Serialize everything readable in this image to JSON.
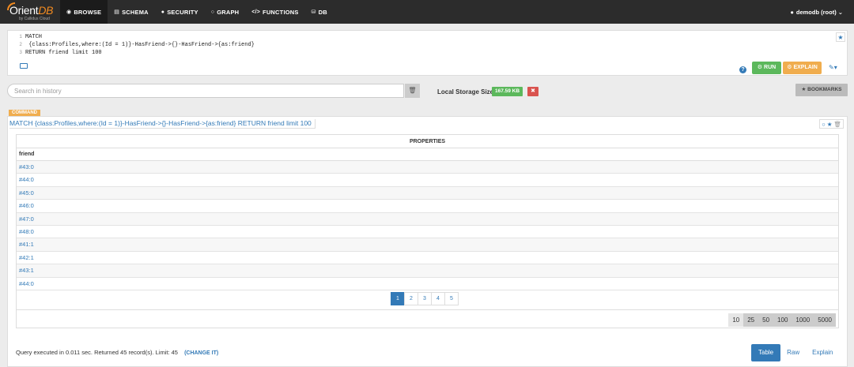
{
  "navbar": {
    "logo_text": "Orient",
    "logo_db": "DB",
    "logo_sub": "by Callidus Cloud",
    "items": [
      {
        "label": "BROWSE",
        "icon": "eye-icon",
        "glyph": "◉",
        "active": true
      },
      {
        "label": "SCHEMA",
        "icon": "table-icon",
        "glyph": "▤",
        "active": false
      },
      {
        "label": "SECURITY",
        "icon": "user-icon",
        "glyph": "👤",
        "active": false
      },
      {
        "label": "GRAPH",
        "icon": "circle-icon",
        "glyph": "○",
        "active": false
      },
      {
        "label": "FUNCTIONS",
        "icon": "code-icon",
        "glyph": "</>",
        "active": false
      },
      {
        "label": "DB",
        "icon": "database-icon",
        "glyph": "⛁",
        "active": false
      }
    ],
    "user": "demodb (root)"
  },
  "editor": {
    "lines": [
      {
        "num": "1",
        "text": "MATCH"
      },
      {
        "num": "2",
        "text": "   {class:Profiles,where:(Id = 1)}-HasFriend->{}-HasFriend->{as:friend}"
      },
      {
        "num": "3",
        "text": "RETURN friend limit 100"
      }
    ],
    "run_label": "RUN",
    "explain_label": "EXPLAIN"
  },
  "history": {
    "placeholder": "Search in history"
  },
  "storage": {
    "label": "Local Storage Size",
    "size": "167.59 KB"
  },
  "bookmarks_label": "BOOKMARKS",
  "result": {
    "tag": "COMMAND",
    "query": "MATCH {class:Profiles,where:(Id = 1)}-HasFriend->{}-HasFriend->{as:friend} RETURN friend limit 100",
    "header": "PROPERTIES",
    "column": "friend",
    "rows": [
      "#43:0",
      "#44:0",
      "#45:0",
      "#46:0",
      "#47:0",
      "#48:0",
      "#41:1",
      "#42:1",
      "#43:1",
      "#44:0"
    ],
    "pages": [
      "1",
      "2",
      "3",
      "4",
      "5"
    ],
    "active_page": "1",
    "page_sizes": [
      "10",
      "25",
      "50",
      "100",
      "1000",
      "5000"
    ],
    "active_size": "10",
    "status": "Query executed in 0.011 sec. Returned 45 record(s). Limit: 45",
    "change_label": "(CHANGE IT)",
    "views": [
      "Table",
      "Raw",
      "Explain"
    ],
    "active_view": "Table"
  }
}
